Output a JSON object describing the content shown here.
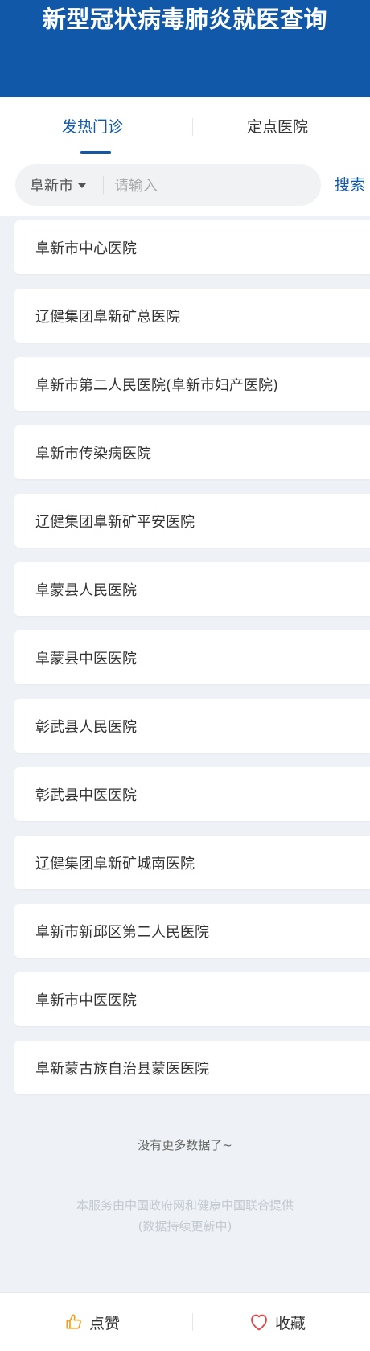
{
  "header": {
    "title": "新型冠状病毒肺炎就医查询"
  },
  "tabs": [
    {
      "label": "发热门诊",
      "active": true
    },
    {
      "label": "定点医院",
      "active": false
    }
  ],
  "search": {
    "city": "阜新市",
    "placeholder": "请输入",
    "value": "",
    "button_label": "搜索"
  },
  "hospitals": [
    "阜新市中心医院",
    "辽健集团阜新矿总医院",
    "阜新市第二人民医院(阜新市妇产医院)",
    "阜新市传染病医院",
    "辽健集团阜新矿平安医院",
    "阜蒙县人民医院",
    "阜蒙县中医医院",
    "彰武县人民医院",
    "彰武县中医医院",
    "辽健集团阜新矿城南医院",
    "阜新市新邱区第二人民医院",
    "阜新市中医医院",
    "阜新蒙古族自治县蒙医医院"
  ],
  "list_end_text": "没有更多数据了~",
  "footer": {
    "line1": "本服务由中国政府网和健康中国联合提供",
    "line2": "(数据持续更新中)"
  },
  "bottom_bar": {
    "like_label": "点赞",
    "like_icon": "thumbs-up-icon",
    "favorite_label": "收藏",
    "favorite_icon": "heart-icon"
  },
  "colors": {
    "primary": "#1258a8",
    "like_icon": "#f0a020",
    "favorite_icon": "#e04848"
  }
}
